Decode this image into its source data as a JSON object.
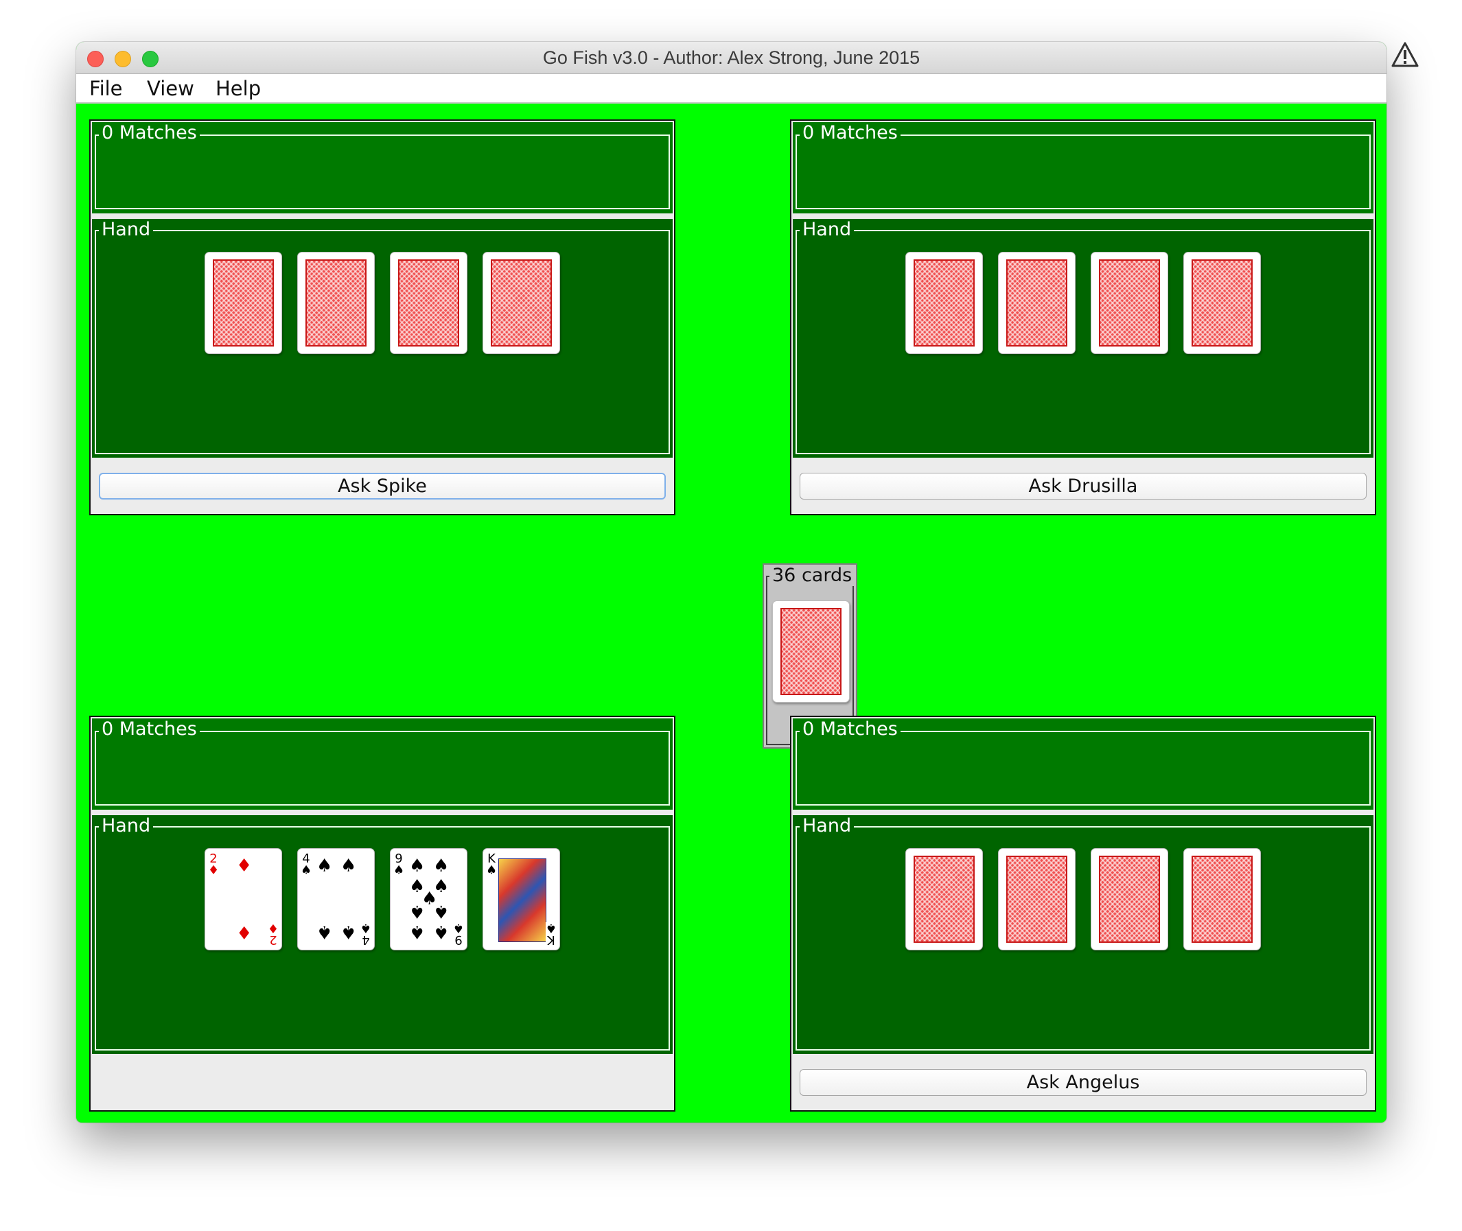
{
  "window": {
    "title": "Go Fish v3.0 - Author: Alex Strong, June 2015"
  },
  "menu": {
    "file": "File",
    "view": "View",
    "help": "Help"
  },
  "colors": {
    "table_green": "#00ff00",
    "matches_green": "#007a00",
    "hand_green": "#006400",
    "card_back_red": "#f05050"
  },
  "deck": {
    "label": "36 cards",
    "card": "card-back"
  },
  "players": {
    "top_left": {
      "matches_label": "0 Matches",
      "hand_label": "Hand",
      "cards": [
        "card-back",
        "card-back",
        "card-back",
        "card-back"
      ],
      "button": "Ask Spike"
    },
    "top_right": {
      "matches_label": "0 Matches",
      "hand_label": "Hand",
      "cards": [
        "card-back",
        "card-back",
        "card-back",
        "card-back"
      ],
      "button": "Ask Drusilla"
    },
    "bottom_left": {
      "matches_label": "0 Matches",
      "hand_label": "Hand",
      "cards": [
        {
          "rank": "2",
          "suit": "♦"
        },
        {
          "rank": "4",
          "suit": "♠"
        },
        {
          "rank": "9",
          "suit": "♠"
        },
        {
          "rank": "K",
          "suit": "♠"
        }
      ]
    },
    "bottom_right": {
      "matches_label": "0 Matches",
      "hand_label": "Hand",
      "cards": [
        "card-back",
        "card-back",
        "card-back",
        "card-back"
      ],
      "button": "Ask Angelus"
    }
  }
}
